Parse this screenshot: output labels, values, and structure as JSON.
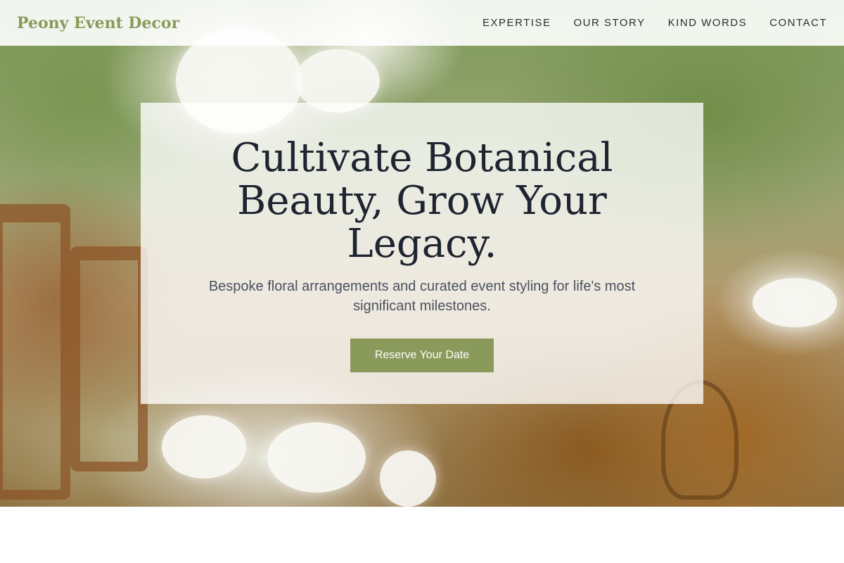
{
  "brand": {
    "name": "Peony Event Decor",
    "color": "#8a9a5b"
  },
  "nav": {
    "items": [
      {
        "label": "EXPERTISE"
      },
      {
        "label": "OUR STORY"
      },
      {
        "label": "KIND WORDS"
      },
      {
        "label": "CONTACT"
      }
    ]
  },
  "hero": {
    "headline": "Cultivate Botanical Beauty, Grow Your Legacy.",
    "subtext": "Bespoke floral arrangements and curated event styling for life's most significant milestones.",
    "cta_label": "Reserve Your Date",
    "accent_color": "#8a9a5b"
  }
}
